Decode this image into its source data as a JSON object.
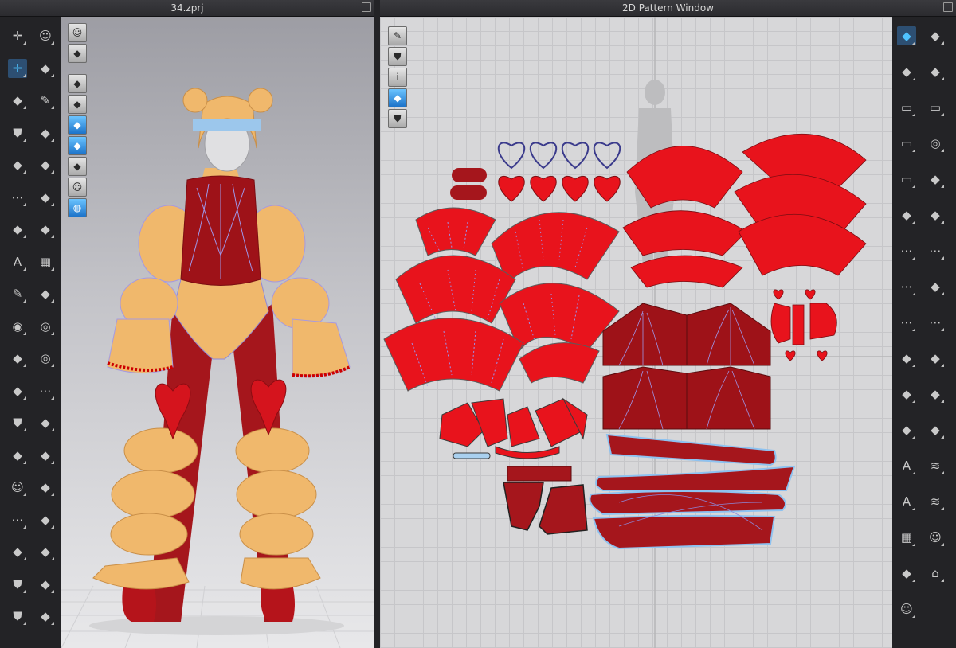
{
  "left_panel": {
    "file_title": "34.zprj"
  },
  "right_panel": {
    "window_title": "2D Pattern Window"
  },
  "colors": {
    "garment_base": "#f0b86c",
    "accent_red": "#e8131c",
    "dark_red": "#9e1218",
    "pattern_bg": "#d7d7d9",
    "selection_blue": "#4fc3ff"
  },
  "left_toolbar": [
    [
      "avatar-move-icon",
      "walk-animation-icon"
    ],
    [
      "translate-gizmo-icon",
      "pin-icon"
    ],
    [
      "select-mesh-icon",
      "brush-icon"
    ],
    [
      "tshirt-select-icon",
      "tack-icon"
    ],
    [
      "fold-arrange-icon",
      "fold-tool-icon"
    ],
    [
      "measure-icon",
      "sync-icon"
    ],
    [
      "steam-icon",
      "zipper-icon"
    ],
    [
      "texture-icon",
      "pattern-grid-icon"
    ],
    [
      "pen-icon",
      "graphic-icon"
    ],
    [
      "eye-hide-icon",
      "button-icon"
    ],
    [
      "edit-tool-icon",
      "buttonhole-icon"
    ],
    [
      "fabric-icon",
      "topstitch-icon"
    ],
    [
      "shirt-icon",
      "puckering-icon"
    ],
    [
      "pants-icon",
      "layer-icon"
    ],
    [
      "avatar-size-icon",
      "fitting-suit-icon"
    ],
    [
      "measure-tape-icon",
      "graduation-icon"
    ],
    [
      "ruler-icon",
      "shrinkage-icon"
    ],
    [
      "dress-icon",
      "trim-icon"
    ],
    [
      "jacket-icon",
      "hanger-icon"
    ]
  ],
  "view_tools": [
    "avatar-render-icon",
    "garment-display-icon",
    "garment-view-icon",
    "mesh-view-icon",
    "strain-map-icon",
    "fabric-render-icon",
    "thickness-icon",
    "avatar-show-icon",
    "globe-icon"
  ],
  "pattern_view_tools": [
    "wand-icon",
    "tshirt-2d-icon",
    "info-icon",
    "fabric-2d-icon",
    "lock-tshirt-icon"
  ],
  "right_toolbar": [
    [
      "transform-pattern-icon",
      "edit-point-icon"
    ],
    [
      "curve-point-icon",
      "add-point-icon"
    ],
    [
      "polygon-icon",
      "rectangle-icon"
    ],
    [
      "internal-polygon-icon",
      "circle-icon"
    ],
    [
      "internal-rect-icon",
      "dart-icon"
    ],
    [
      "trace-icon",
      "iron-icon"
    ],
    [
      "segment-sew-icon",
      "free-sew-icon"
    ],
    [
      "line-sew-icon",
      "tuck-icon"
    ],
    [
      "edit-sew-icon",
      "check-sew-icon"
    ],
    [
      "pleat-icon",
      "fold-icon"
    ],
    [
      "notch-icon",
      "seam-allowance-icon"
    ],
    [
      "binding-icon",
      "gather-icon"
    ],
    [
      "text-add-icon",
      "elastic-icon"
    ],
    [
      "text-edit-icon",
      "zigzag-icon"
    ],
    [
      "grid-icon",
      "puppet-icon"
    ],
    [
      "pattern-copy-icon",
      "gift-icon"
    ],
    [
      "avatar-2d-icon",
      ""
    ]
  ]
}
